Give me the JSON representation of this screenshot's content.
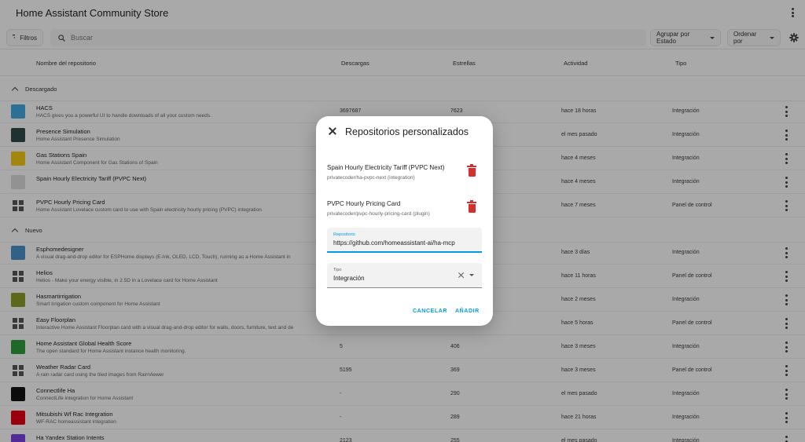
{
  "app": {
    "title": "Home Assistant Community Store"
  },
  "toolbar": {
    "filters_label": "Filtros",
    "search_placeholder": "Buscar",
    "group_by_label": "Agrupar por Estado",
    "sort_by_label": "Ordenar por"
  },
  "columns": {
    "name": "Nombre del repositorio",
    "downloads": "Descargas",
    "stars": "Estrellas",
    "activity": "Actividad",
    "type": "Tipo"
  },
  "groups": {
    "downloaded": "Descargado",
    "new": "Nuevo"
  },
  "downloaded_rows": [
    {
      "name": "HACS",
      "desc": "HACS gives you a powerful UI to handle downloads of all your custom needs.",
      "downloads": "3697687",
      "stars": "7623",
      "activity": "hace 18 horas",
      "type": "Integración",
      "icon": "hacs-logo-icon",
      "color": "#41a5dc"
    },
    {
      "name": "Presence Simulation",
      "desc": "Home Assistant Presence Simulation",
      "downloads": "",
      "stars": "",
      "activity": "el mes pasado",
      "type": "Integración",
      "icon": "presence-simulation-logo-icon",
      "color": "#2d4a4a"
    },
    {
      "name": "Gas Stations Spain",
      "desc": "Home Assistant Component for Gas Stations of Spain",
      "downloads": "",
      "stars": "",
      "activity": "hace 4 meses",
      "type": "Integración",
      "icon": "gas-pump-icon",
      "color": "#f0c419"
    },
    {
      "name": "Spain Hourly Electricity Tariff (PVPC Next)",
      "desc": "",
      "downloads": "",
      "stars": "",
      "activity": "hace 4 meses",
      "type": "Integración",
      "icon": "placeholder-image-icon",
      "color": "#d8d8d8"
    },
    {
      "name": "PVPC Hourly Pricing Card",
      "desc": "Home Assistant Lovelace custom card to use with Spain electricity hourly pricing (PVPC) integration",
      "downloads": "",
      "stars": "",
      "activity": "hace 7 meses",
      "type": "Panel de control",
      "icon": "dashboard-grid-icon",
      "color": "#555555"
    }
  ],
  "new_rows": [
    {
      "name": "Esphomedesigner",
      "desc": "A visual drag-and-drop editor for ESPHome displays (E-Ink, OLED, LCD, Touch), running as a Home Assistant in",
      "downloads": "",
      "stars": "",
      "activity": "hace 3 días",
      "type": "Integración",
      "icon": "esphome-display-icon",
      "color": "#4a90c8"
    },
    {
      "name": "Helios",
      "desc": "Helios - Make your energy visible, in 2.5D in a Lovelace card for Home Assistant",
      "downloads": "",
      "stars": "",
      "activity": "hace 11 horas",
      "type": "Panel de control",
      "icon": "dashboard-grid-icon",
      "color": "#555555"
    },
    {
      "name": "Hasmartirrigation",
      "desc": "Smart Irrigation custom component for Home Assistant",
      "downloads": "",
      "stars": "",
      "activity": "hace 2 meses",
      "type": "Integración",
      "icon": "irrigation-logo-icon",
      "color": "#8a9a2a"
    },
    {
      "name": "Easy Floorplan",
      "desc": "Interactive Home Assistant Floorplan card with a visual drag-and-drop editor for walls, doors, furniture, text and de",
      "downloads": "",
      "stars": "",
      "activity": "hace 5 horas",
      "type": "Panel de control",
      "icon": "dashboard-grid-icon",
      "color": "#555555"
    },
    {
      "name": "Home Assistant Global Health Score",
      "desc": "The open standard for Home Assistant instance health monitoring.",
      "downloads": "5",
      "stars": "406",
      "activity": "hace 3 meses",
      "type": "Integración",
      "icon": "health-score-logo-icon",
      "color": "#2e9a3e"
    },
    {
      "name": "Weather Radar Card",
      "desc": "A rain radar card using the tiled images from RainViewer",
      "downloads": "5195",
      "stars": "369",
      "activity": "hace 3 meses",
      "type": "Panel de control",
      "icon": "dashboard-grid-icon",
      "color": "#555555"
    },
    {
      "name": "Connectlife Ha",
      "desc": "ConnectLife integration for Home Assistant",
      "downloads": "-",
      "stars": "290",
      "activity": "el mes pasado",
      "type": "Integración",
      "icon": "connectlife-logo-icon",
      "color": "#111111"
    },
    {
      "name": "Mitsubishi Wf Rac Integration",
      "desc": "WF-RAC homeassistant integration",
      "downloads": "-",
      "stars": "289",
      "activity": "hace 21 horas",
      "type": "Integración",
      "icon": "mitsubishi-logo-icon",
      "color": "#e60012"
    },
    {
      "name": "Ha Yandex Station Intents",
      "desc": "",
      "downloads": "2123",
      "stars": "255",
      "activity": "el mes pasado",
      "type": "Integración",
      "icon": "yandex-station-logo-icon",
      "color": "#7b3fe4"
    }
  ],
  "dialog": {
    "title": "Repositorios personalizados",
    "repos": [
      {
        "name": "Spain Hourly Electricity Tariff (PVPC Next)",
        "sub": "privatecoder/ha-pvpc-next (integration)"
      },
      {
        "name": "PVPC Hourly Pricing Card",
        "sub": "privatecoder/pvpc-hourly-pricing-card (plugin)"
      }
    ],
    "repo_field_label": "Repositorio",
    "repo_field_value": "https://github.com/homeassistant-ai/ha-mcp",
    "type_field_label": "Tipo",
    "type_field_value": "Integración",
    "cancel_label": "CANCELAR",
    "add_label": "AÑADIR",
    "accent_color": "#039be5",
    "delete_color": "#d32f2f"
  }
}
